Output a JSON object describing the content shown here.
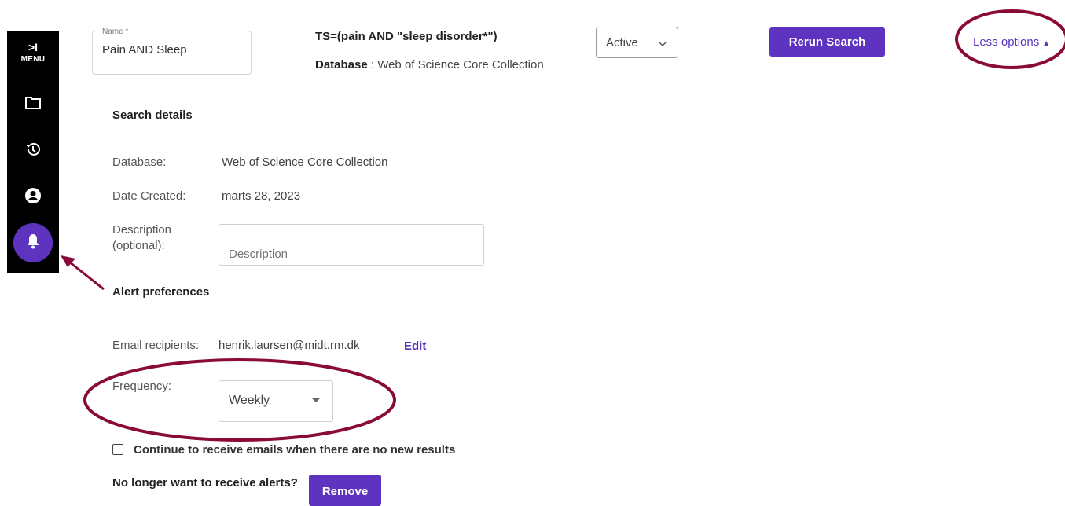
{
  "sidebar": {
    "menu_label": "MENU",
    "menu_chevron": ">I",
    "icons": [
      "folder-icon",
      "history-icon",
      "account-icon",
      "bell-icon"
    ],
    "active_color": "#5e33bf"
  },
  "header": {
    "name_legend": "Name *",
    "name_value": "Pain AND Sleep",
    "query": "TS=(pain AND \"sleep disorder*\")",
    "database_label": "Database",
    "database_value": " : Web of Science Core Collection",
    "status_value": "Active",
    "rerun_label": "Rerun Search",
    "less_options_label": "Less options"
  },
  "search_details": {
    "title": "Search details",
    "database_label": "Database:",
    "database_value": "Web of Science Core Collection",
    "date_label": "Date Created:",
    "date_value": "marts 28, 2023",
    "description_label_1": "Description",
    "description_label_2": "(optional):",
    "description_placeholder": "Description"
  },
  "alert_preferences": {
    "title": "Alert preferences",
    "email_label": "Email recipients:",
    "email_value": "henrik.laursen@midt.rm.dk",
    "edit_label": "Edit",
    "frequency_label": "Frequency:",
    "frequency_value": "Weekly",
    "continue_label": "Continue to receive emails when there are no new results",
    "no_longer_label": "No longer want to receive alerts?",
    "remove_label": "Remove"
  },
  "colors": {
    "accent": "#5e33bf",
    "annotation": "#8a0a3a"
  }
}
